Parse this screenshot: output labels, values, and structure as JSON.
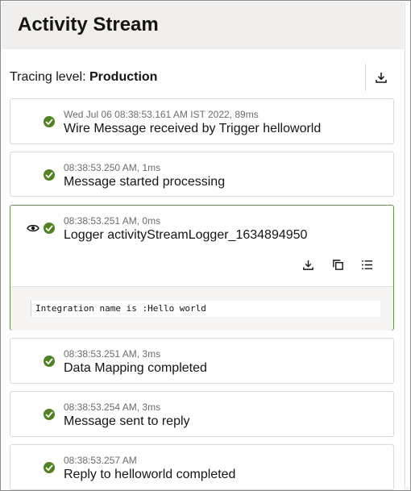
{
  "header": {
    "title": "Activity Stream"
  },
  "tracing": {
    "label": "Tracing level: ",
    "value": "Production"
  },
  "colors": {
    "success": "#508223",
    "header_bg": "#f1efed",
    "expanded_border": "#6a8f4c"
  },
  "entries": [
    {
      "meta": "Wed Jul 06 08:38:53.161 AM IST 2022, 89ms",
      "title": "Wire Message received by Trigger helloworld",
      "status_icon": "check-circle-icon"
    },
    {
      "meta": "08:38:53.250 AM, 1ms",
      "title": "Message started processing",
      "status_icon": "check-circle-icon"
    },
    {
      "meta": "08:38:53.251 AM, 0ms",
      "title": "Logger activityStreamLogger_1634894950",
      "status_icon": "check-circle-icon",
      "log": "Integration name is :Hello world"
    },
    {
      "meta": "08:38:53.251 AM, 3ms",
      "title": "Data Mapping completed",
      "status_icon": "check-circle-icon"
    },
    {
      "meta": "08:38:53.254 AM, 3ms",
      "title": "Message sent to reply",
      "status_icon": "check-circle-icon"
    },
    {
      "meta": "08:38:53.257 AM",
      "title": "Reply to helloworld completed",
      "status_icon": "check-circle-icon"
    }
  ]
}
